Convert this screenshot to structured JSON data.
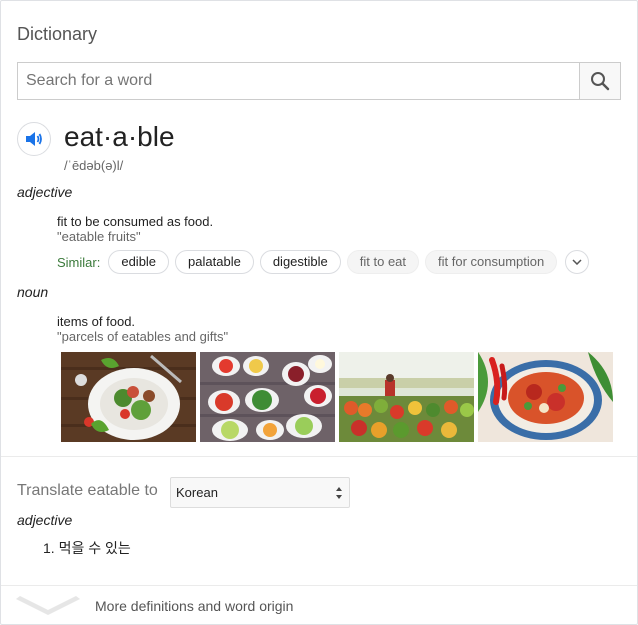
{
  "dictionary": {
    "title": "Dictionary"
  },
  "search": {
    "placeholder": "Search for a word",
    "value": ""
  },
  "entry": {
    "word": "eat·a·ble",
    "phonetic": "/ˈēdəb(ə)l/",
    "senses": [
      {
        "pos": "adjective",
        "definition": "fit to be consumed as food.",
        "example": "\"eatable fruits\"",
        "similar_label": "Similar:",
        "similar": [
          "edible",
          "palatable",
          "digestible",
          "fit to eat",
          "fit for consumption"
        ]
      },
      {
        "pos": "noun",
        "definition": "items of food.",
        "example": "\"parcels of eatables and gifts\""
      }
    ]
  },
  "images": [
    {
      "icon": "salad-plate-image"
    },
    {
      "icon": "fruit-bowls-image"
    },
    {
      "icon": "vegetable-market-image"
    },
    {
      "icon": "chili-noodle-bowl-image"
    }
  ],
  "translate": {
    "label": "Translate eatable to",
    "language": "Korean",
    "pos": "adjective",
    "items": [
      "1. 먹을 수 있는"
    ]
  },
  "more": {
    "label": "More definitions and word origin"
  },
  "colors": {
    "accent": "#1a73e8",
    "similar_green": "#3b7a3b"
  }
}
